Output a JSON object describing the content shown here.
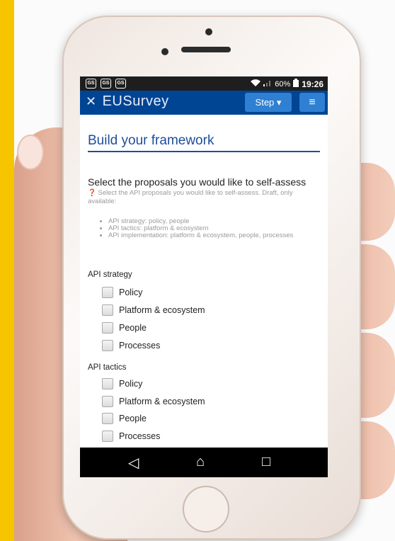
{
  "status_bar": {
    "battery": "60%",
    "time": "19:26",
    "notif_icons": [
      "GS",
      "GS",
      "GS"
    ]
  },
  "app": {
    "name": "EUSurvey",
    "step_button": "Step ▾",
    "menu_icon": "hamburger"
  },
  "page": {
    "title": "Build your framework",
    "question": "Select the proposals you would like to self-assess",
    "help": "Select the API proposals you would like to self-assess. Draft, only available:",
    "bullets": [
      "API strategy: policy, people",
      "API tactics: platform & ecosystem",
      "API implementation: platform & ecosystem, people, processes"
    ],
    "groups": [
      {
        "label": "API strategy",
        "options": [
          "Policy",
          "Platform & ecosystem",
          "People",
          "Processes"
        ]
      },
      {
        "label": "API tactics",
        "options": [
          "Policy",
          "Platform & ecosystem",
          "People",
          "Processes"
        ]
      }
    ]
  },
  "softkeys": {
    "back": "◁",
    "home": "⌂",
    "recent": "□"
  },
  "colors": {
    "navbar": "#004494",
    "button": "#2f7fd2",
    "title": "#1d4e9b",
    "frame_bg": "#f6c500"
  }
}
